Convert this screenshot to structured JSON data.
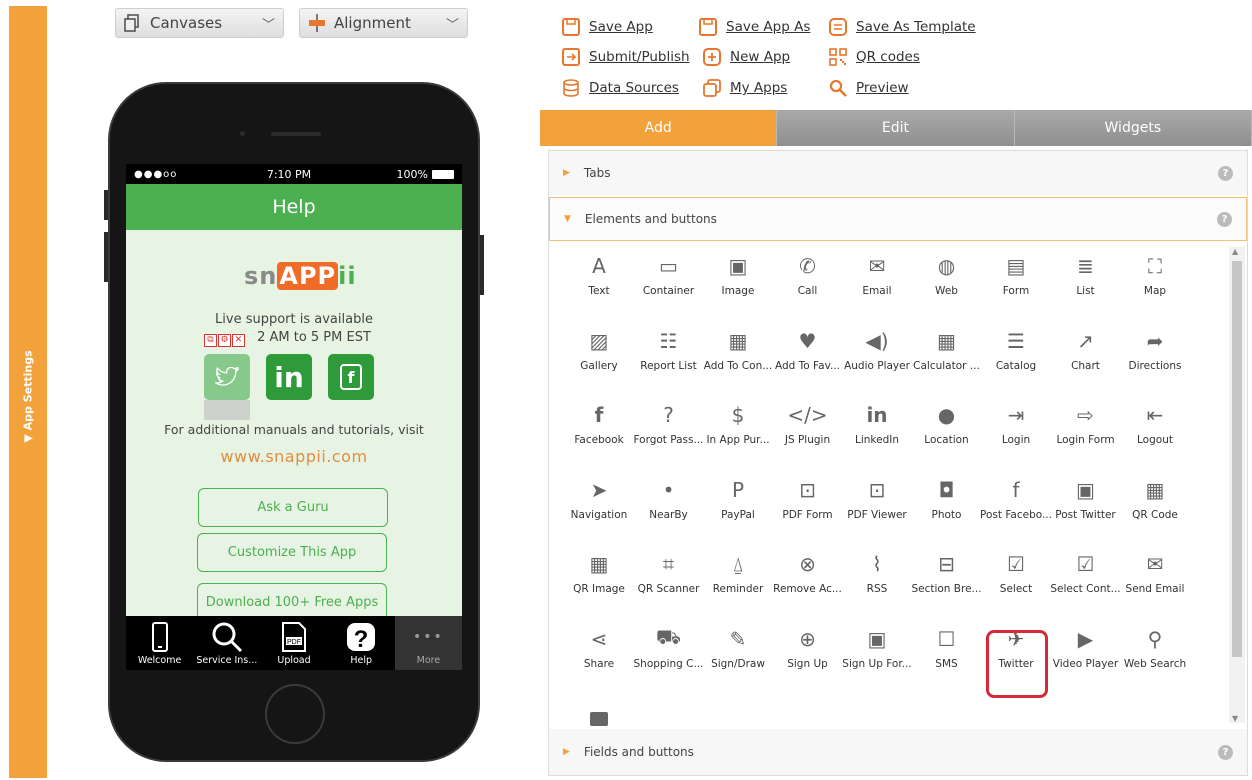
{
  "sidebar": {
    "app_settings_label": "▼  App Settings"
  },
  "toolbar_top": {
    "canvases_label": "Canvases",
    "alignment_label": "Alignment"
  },
  "links": {
    "save_app": "Save App",
    "save_app_as": "Save App As",
    "save_as_template": "Save As Template",
    "submit_publish": "Submit/Publish",
    "new_app": "New App",
    "qr_codes": "QR codes",
    "data_sources": "Data Sources",
    "my_apps": "My Apps",
    "preview": "Preview"
  },
  "phone": {
    "status": {
      "signal": "●●●oo",
      "time": "7:10 PM",
      "battery": "100%"
    },
    "nav_title": "Help",
    "logo": {
      "a": "sn",
      "b": "APP",
      "c": "ii"
    },
    "support_line1": "Live support is available",
    "support_line2": "2 AM to 5 PM EST",
    "social": {
      "linkedin": "in",
      "facebook": "f"
    },
    "manuals_text": "For additional manuals and tutorials, visit",
    "site": "www.snappii.com",
    "buttons": [
      "Ask a Guru",
      "Customize This App",
      "Download 100+ Free Apps"
    ],
    "tabs": [
      "Welcome",
      "Service Ins...",
      "Upload",
      "Help",
      "More"
    ]
  },
  "panel": {
    "tabs": [
      "Add",
      "Edit",
      "Widgets"
    ],
    "sections": {
      "tabs": "Tabs",
      "elements": "Elements and buttons",
      "fields": "Fields and buttons"
    },
    "help_glyph": "?",
    "widgets": [
      "Text",
      "Container",
      "Image",
      "Call",
      "Email",
      "Web",
      "Form",
      "List",
      "Map",
      "Gallery",
      "Report List",
      "Add To Con...",
      "Add To Fav...",
      "Audio Player",
      "Calculator ...",
      "Catalog",
      "Chart",
      "Directions",
      "Facebook",
      "Forgot Pass...",
      "In App Pur...",
      "JS Plugin",
      "LinkedIn",
      "Location",
      "Login",
      "Login Form",
      "Logout",
      "Navigation",
      "NearBy",
      "PayPal",
      "PDF Form",
      "PDF Viewer",
      "Photo",
      "Post Facebo...",
      "Post Twitter",
      "QR Code",
      "QR Image",
      "QR Scanner",
      "Reminder",
      "Remove Ac...",
      "RSS",
      "Section Bre...",
      "Select",
      "Select Cont...",
      "Send Email",
      "Share",
      "Shopping C...",
      "Sign/Draw",
      "Sign Up",
      "Sign Up For...",
      "SMS",
      "Twitter",
      "Video Player",
      "Web Search"
    ],
    "icons": [
      "text-icon",
      "container-icon",
      "image-icon",
      "call-icon",
      "email-icon",
      "web-icon",
      "form-icon",
      "list-icon",
      "map-icon",
      "gallery-icon",
      "report-list-icon",
      "add-to-contacts-icon",
      "add-to-favorites-icon",
      "audio-player-icon",
      "calculator-icon",
      "catalog-icon",
      "chart-icon",
      "directions-icon",
      "facebook-icon",
      "forgot-password-icon",
      "in-app-purchase-icon",
      "js-plugin-icon",
      "linkedin-icon",
      "location-icon",
      "login-icon",
      "login-form-icon",
      "logout-icon",
      "navigation-icon",
      "nearby-icon",
      "paypal-icon",
      "pdf-form-icon",
      "pdf-viewer-icon",
      "photo-icon",
      "post-facebook-icon",
      "post-twitter-icon",
      "qr-code-icon",
      "qr-image-icon",
      "qr-scanner-icon",
      "reminder-icon",
      "remove-account-icon",
      "rss-icon",
      "section-break-icon",
      "select-icon",
      "select-contact-icon",
      "send-email-icon",
      "share-icon",
      "shopping-cart-icon",
      "sign-draw-icon",
      "sign-up-icon",
      "sign-up-form-icon",
      "sms-icon",
      "twitter-icon",
      "video-player-icon",
      "web-search-icon"
    ],
    "glyphs": [
      "A",
      "▭",
      "▣",
      "✆",
      "✉",
      "◍",
      "▤",
      "≣",
      "⛶",
      "▨",
      "☷",
      "▦",
      "♥",
      "◀)",
      "▦",
      "☰",
      "↗",
      "➦",
      "f",
      "?",
      "$",
      "</>",
      "in",
      "●",
      "⇥",
      "⇨",
      "⇤",
      "➤",
      "•",
      "P",
      "⊡",
      "⊡",
      "◘",
      "f",
      "▣",
      "▦",
      "▦",
      "⌗",
      "⍙",
      "⊗",
      "⌇",
      "⊟",
      "☑",
      "☑",
      "✉",
      "⋖",
      "⛟",
      "✎",
      "⊕",
      "▣",
      "☐",
      "✈",
      "▶",
      "⚲"
    ]
  },
  "colors": {
    "accent": "#f3a23b",
    "green": "#4caf50",
    "highlight": "#d42b3a"
  }
}
